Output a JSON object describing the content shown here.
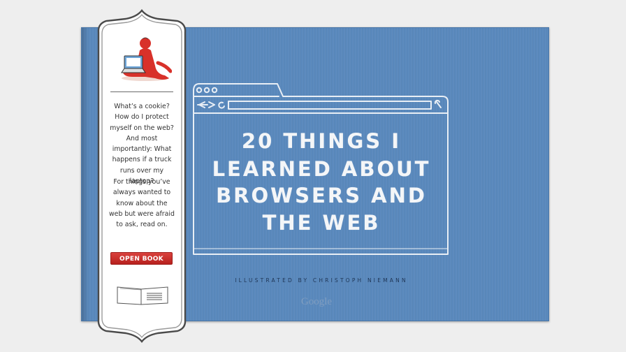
{
  "cover": {
    "title_lines": [
      "20 THINGS I",
      "LEARNED ABOUT",
      "BROWSERS AND",
      "THE WEB"
    ],
    "credit": "ILLUSTRATED BY CHRISTOPH NIEMANN",
    "publisher": "Google"
  },
  "sidebar": {
    "intro": "What’s a cookie? How do I protect myself on the web? And most importantly: What happens if a truck runs over my laptop?",
    "followup": "For things you’ve always wanted to know about the web but were afraid to ask, read on.",
    "open_button": "OPEN BOOK"
  },
  "icons": {
    "illustration": "person-with-laptop-icon",
    "book": "open-book-icon"
  },
  "colors": {
    "cover": "#5a89bd",
    "sketch": "#e8eef5",
    "button": "#c9302c",
    "background": "#eeeeee"
  }
}
